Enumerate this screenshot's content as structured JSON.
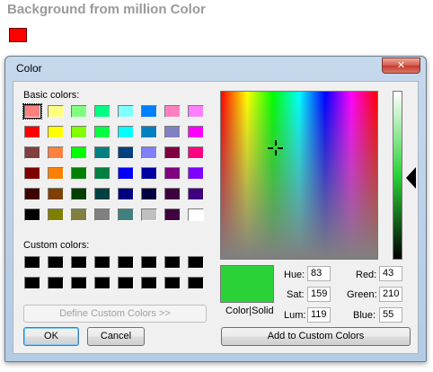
{
  "page": {
    "heading": "Background from million Color",
    "swatch_color": "#ff0000"
  },
  "dialog": {
    "title": "Color",
    "close_symbol": "✕",
    "basic_colors_label": "Basic colors:",
    "custom_colors_label": "Custom colors:",
    "basic_colors": [
      "#ff8080",
      "#ffff80",
      "#80ff80",
      "#00ff80",
      "#80ffff",
      "#0080ff",
      "#ff80c0",
      "#ff80ff",
      "#ff0000",
      "#ffff00",
      "#80ff00",
      "#00ff40",
      "#00ffff",
      "#0080c0",
      "#8080c0",
      "#ff00ff",
      "#804040",
      "#ff8040",
      "#00ff00",
      "#008080",
      "#004080",
      "#8080ff",
      "#800040",
      "#ff0080",
      "#800000",
      "#ff8000",
      "#008000",
      "#008040",
      "#0000ff",
      "#0000a0",
      "#800080",
      "#8000ff",
      "#400000",
      "#804000",
      "#004000",
      "#004040",
      "#000080",
      "#000040",
      "#400040",
      "#400080",
      "#000000",
      "#808000",
      "#808040",
      "#808080",
      "#408080",
      "#c0c0c0",
      "#400040",
      "#ffffff"
    ],
    "selected_basic_index": 0,
    "custom_colors": [
      "#000000",
      "#000000",
      "#000000",
      "#000000",
      "#000000",
      "#000000",
      "#000000",
      "#000000",
      "#000000",
      "#000000",
      "#000000",
      "#000000",
      "#000000",
      "#000000",
      "#000000",
      "#000000"
    ],
    "define_custom_label": "Define Custom Colors >>",
    "ok_label": "OK",
    "cancel_label": "Cancel",
    "preview_label": "Color|Solid",
    "preview_color": "#2bd237",
    "add_custom_label": "Add to Custom Colors",
    "hsl": {
      "hue_label": "Hue:",
      "hue": "83",
      "sat_label": "Sat:",
      "sat": "159",
      "lum_label": "Lum:",
      "lum": "119"
    },
    "rgb": {
      "red_label": "Red:",
      "red": "43",
      "green_label": "Green:",
      "green": "210",
      "blue_label": "Blue:",
      "blue": "55"
    }
  }
}
